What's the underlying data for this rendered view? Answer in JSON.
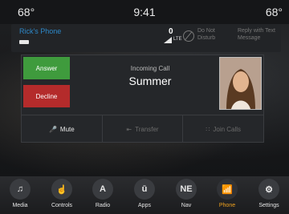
{
  "topbar": {
    "temp_left": "68°",
    "time": "9:41",
    "temp_right": "68°"
  },
  "status": {
    "phone_name": "Rick's Phone",
    "signal_count": "0",
    "network": "LTE",
    "dnd_label": "Do Not Disturb",
    "reply_label": "Reply with Text Message"
  },
  "call": {
    "answer_label": "Answer",
    "decline_label": "Decline",
    "incoming_label": "Incoming Call",
    "caller_name": "Summer",
    "mute_label": "Mute",
    "transfer_label": "Transfer",
    "join_label": "Join Calls"
  },
  "dock": {
    "items": [
      {
        "label": "Media",
        "icon": "♫"
      },
      {
        "label": "Controls",
        "icon": "☝"
      },
      {
        "label": "Radio",
        "icon": "A"
      },
      {
        "label": "Apps",
        "icon": "ū"
      },
      {
        "label": "Nav",
        "icon": "NE"
      },
      {
        "label": "Phone",
        "icon": "📶"
      },
      {
        "label": "Settings",
        "icon": "⚙"
      }
    ],
    "active": "Phone"
  },
  "colors": {
    "answer": "#3f9b3d",
    "decline": "#b42b2b",
    "accent": "#f1a31e",
    "phone_name": "#2d88c9"
  }
}
